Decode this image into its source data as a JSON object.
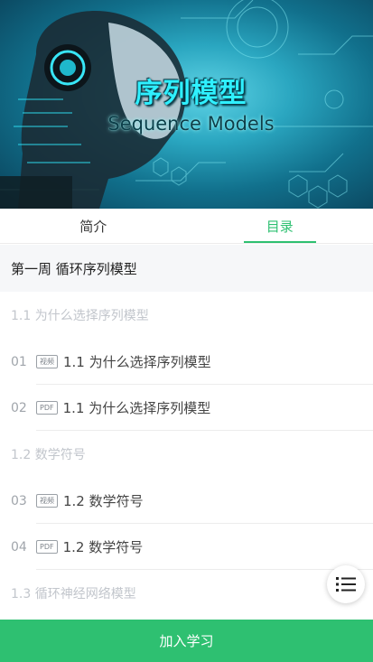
{
  "banner": {
    "title": "序列模型",
    "subtitle": "Sequence Models",
    "image_icon": "robot-head-circuit"
  },
  "tabs": [
    {
      "label": "简介",
      "active": false
    },
    {
      "label": "目录",
      "active": true
    }
  ],
  "week": {
    "title": "第一周 循环序列模型"
  },
  "sections": [
    {
      "title": "1.1 为什么选择序列模型",
      "items": [
        {
          "num": "01",
          "type": "视频",
          "title": "1.1 为什么选择序列模型"
        },
        {
          "num": "02",
          "type": "PDF",
          "title": "1.1 为什么选择序列模型"
        }
      ]
    },
    {
      "title": "1.2 数学符号",
      "items": [
        {
          "num": "03",
          "type": "视频",
          "title": "1.2 数学符号"
        },
        {
          "num": "04",
          "type": "PDF",
          "title": "1.2 数学符号"
        }
      ]
    },
    {
      "title": "1.3 循环神经网络模型",
      "items": []
    }
  ],
  "fab": {
    "icon": "list-menu-icon"
  },
  "join_button": {
    "label": "加入学习"
  },
  "colors": {
    "accent": "#2ec071",
    "muted": "#c2c6cc",
    "week_bg": "#f6f7f9"
  }
}
